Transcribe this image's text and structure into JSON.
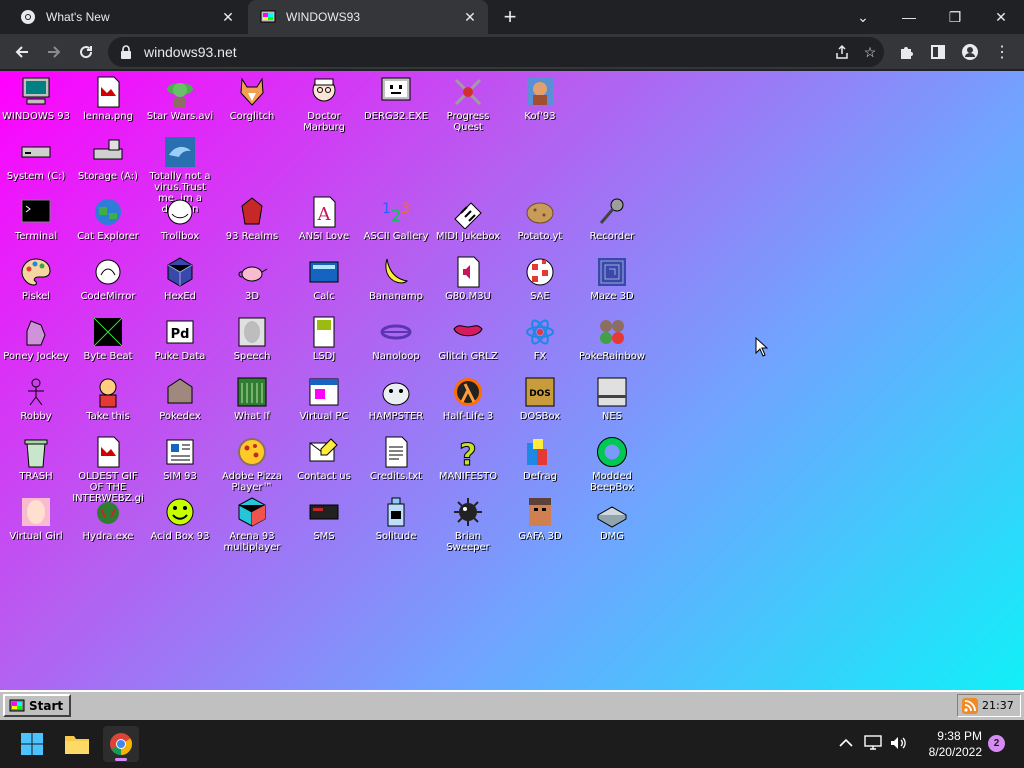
{
  "browser": {
    "tabs": [
      {
        "title": "What's New",
        "active": false,
        "icon": "chrome-icon"
      },
      {
        "title": "WINDOWS93",
        "active": true,
        "icon": "windows93-icon"
      }
    ],
    "url": "windows93.net"
  },
  "desktop": {
    "icons": [
      {
        "label": "WINDOWS 93",
        "icon": "computer-icon",
        "col": 0,
        "row": 0
      },
      {
        "label": "lenna.png",
        "icon": "image-file-icon",
        "col": 1,
        "row": 0
      },
      {
        "label": "Star Wars.avi",
        "icon": "yoda-icon",
        "col": 2,
        "row": 0
      },
      {
        "label": "Corglitch",
        "icon": "corgi-icon",
        "col": 3,
        "row": 0
      },
      {
        "label": "Doctor Marburg",
        "icon": "doctor-icon",
        "col": 4,
        "row": 0
      },
      {
        "label": "DERG32.EXE",
        "icon": "monitor-face-icon",
        "col": 5,
        "row": 0
      },
      {
        "label": "Progress Quest",
        "icon": "crossed-swords-icon",
        "col": 6,
        "row": 0
      },
      {
        "label": "Kof'93",
        "icon": "fighter-icon",
        "col": 7,
        "row": 0
      },
      {
        "label": "System (C:)",
        "icon": "drive-icon",
        "col": 0,
        "row": 1
      },
      {
        "label": "Storage (A:)",
        "icon": "floppy-drive-icon",
        "col": 1,
        "row": 1
      },
      {
        "label": "Totally not a virus.Trust me..im a dolphin",
        "icon": "dolphin-icon",
        "col": 2,
        "row": 1
      },
      {
        "label": "Terminal",
        "icon": "terminal-icon",
        "col": 0,
        "row": 2
      },
      {
        "label": "Cat Explorer",
        "icon": "cat-globe-icon",
        "col": 1,
        "row": 2
      },
      {
        "label": "Trollbox",
        "icon": "troll-icon",
        "col": 2,
        "row": 2
      },
      {
        "label": "93 Realms",
        "icon": "realms-icon",
        "col": 3,
        "row": 2
      },
      {
        "label": "ANSI Love",
        "icon": "ansi-icon",
        "col": 4,
        "row": 2
      },
      {
        "label": "ASCII Gallery",
        "icon": "ascii-icon",
        "col": 5,
        "row": 2
      },
      {
        "label": "MIDI Jukebox",
        "icon": "piano-icon",
        "col": 6,
        "row": 2
      },
      {
        "label": "Potato.yt",
        "icon": "potato-icon",
        "col": 7,
        "row": 2
      },
      {
        "label": "Recorder",
        "icon": "microphone-icon",
        "col": 8,
        "row": 2
      },
      {
        "label": "Piskel",
        "icon": "palette-icon",
        "col": 0,
        "row": 3
      },
      {
        "label": "CodeMirror",
        "icon": "codemirror-icon",
        "col": 1,
        "row": 3
      },
      {
        "label": "HexEd",
        "icon": "cube-icon",
        "col": 2,
        "row": 3
      },
      {
        "label": "3D",
        "icon": "teapot-icon",
        "col": 3,
        "row": 3
      },
      {
        "label": "Calc",
        "icon": "calculator-icon",
        "col": 4,
        "row": 3
      },
      {
        "label": "Bananamp",
        "icon": "banana-icon",
        "col": 5,
        "row": 3
      },
      {
        "label": "G80.M3U",
        "icon": "playlist-file-icon",
        "col": 6,
        "row": 3
      },
      {
        "label": "SAE",
        "icon": "checkered-ball-icon",
        "col": 7,
        "row": 3
      },
      {
        "label": "Maze 3D",
        "icon": "maze-icon",
        "col": 8,
        "row": 3
      },
      {
        "label": "Poney Jockey",
        "icon": "pony-icon",
        "col": 0,
        "row": 4
      },
      {
        "label": "Byte Beat",
        "icon": "bytebeat-icon",
        "col": 1,
        "row": 4
      },
      {
        "label": "Puke Data",
        "icon": "puke-data-icon",
        "col": 2,
        "row": 4
      },
      {
        "label": "Speech",
        "icon": "speech-face-icon",
        "col": 3,
        "row": 4
      },
      {
        "label": "LSDJ",
        "icon": "gameboy-icon",
        "col": 4,
        "row": 4
      },
      {
        "label": "Nanoloop",
        "icon": "nanoloop-icon",
        "col": 5,
        "row": 4
      },
      {
        "label": "Glitch GRLZ",
        "icon": "lips-icon",
        "col": 6,
        "row": 4
      },
      {
        "label": "FX",
        "icon": "atom-icon",
        "col": 7,
        "row": 4
      },
      {
        "label": "PokeRainbow",
        "icon": "pokerainbow-icon",
        "col": 8,
        "row": 4
      },
      {
        "label": "Robby",
        "icon": "stick-figure-icon",
        "col": 0,
        "row": 5
      },
      {
        "label": "Take this",
        "icon": "take-this-icon",
        "col": 1,
        "row": 5
      },
      {
        "label": "Pokedex",
        "icon": "pokedex-icon",
        "col": 2,
        "row": 5
      },
      {
        "label": "What If",
        "icon": "whatif-icon",
        "col": 3,
        "row": 5
      },
      {
        "label": "Virtual PC",
        "icon": "window-icon",
        "col": 4,
        "row": 5
      },
      {
        "label": "HAMPSTER",
        "icon": "hamster-icon",
        "col": 5,
        "row": 5
      },
      {
        "label": "Half-Life 3",
        "icon": "lambda-icon",
        "col": 6,
        "row": 5
      },
      {
        "label": "DOSBox",
        "icon": "dosbox-icon",
        "col": 7,
        "row": 5
      },
      {
        "label": "NES",
        "icon": "nes-icon",
        "col": 8,
        "row": 5
      },
      {
        "label": "TRASH",
        "icon": "trash-icon",
        "col": 0,
        "row": 6
      },
      {
        "label": "OLDEST GIF OF THE INTERWEBZ.gif",
        "icon": "gif-file-icon",
        "col": 1,
        "row": 6
      },
      {
        "label": "SIM 93",
        "icon": "sim-icon",
        "col": 2,
        "row": 6
      },
      {
        "label": "Adobe Pizza Player™",
        "icon": "pizza-icon",
        "col": 3,
        "row": 6
      },
      {
        "label": "Contact us",
        "icon": "contact-icon",
        "col": 4,
        "row": 6
      },
      {
        "label": "Credits.txt",
        "icon": "text-file-icon",
        "col": 5,
        "row": 6
      },
      {
        "label": "MANIFESTO",
        "icon": "question-mark-icon",
        "col": 6,
        "row": 6
      },
      {
        "label": "Defrag",
        "icon": "defrag-icon",
        "col": 7,
        "row": 6
      },
      {
        "label": "Modded BeepBox",
        "icon": "ring-icon",
        "col": 8,
        "row": 6
      },
      {
        "label": "Virtual Girl",
        "icon": "virtual-girl-icon",
        "col": 0,
        "row": 7
      },
      {
        "label": "Hydra.exe",
        "icon": "hydra-icon",
        "col": 1,
        "row": 7
      },
      {
        "label": "Acid Box 93",
        "icon": "smiley-icon",
        "col": 2,
        "row": 7
      },
      {
        "label": "Arena 93 multiplayer",
        "icon": "arena-cube-icon",
        "col": 3,
        "row": 7
      },
      {
        "label": "SMS",
        "icon": "console-icon",
        "col": 4,
        "row": 7
      },
      {
        "label": "Solitude",
        "icon": "bottle-icon",
        "col": 5,
        "row": 7
      },
      {
        "label": "Brian Sweeper",
        "icon": "mine-icon",
        "col": 6,
        "row": 7
      },
      {
        "label": "GAFA 3D",
        "icon": "doomguy-icon",
        "col": 7,
        "row": 7
      },
      {
        "label": "DMG",
        "icon": "dmg-icon",
        "col": 8,
        "row": 7
      }
    ]
  },
  "taskbar93": {
    "start_label": "Start",
    "time": "21:37"
  },
  "os_taskbar": {
    "time": "9:38 PM",
    "date": "8/20/2022",
    "notification_count": "2"
  },
  "colors": {
    "desktop_gradient": [
      "#ff00ff",
      "#10f0f8"
    ],
    "win93_taskbar": "#c0c0c0",
    "accent": "#d58cf2"
  }
}
